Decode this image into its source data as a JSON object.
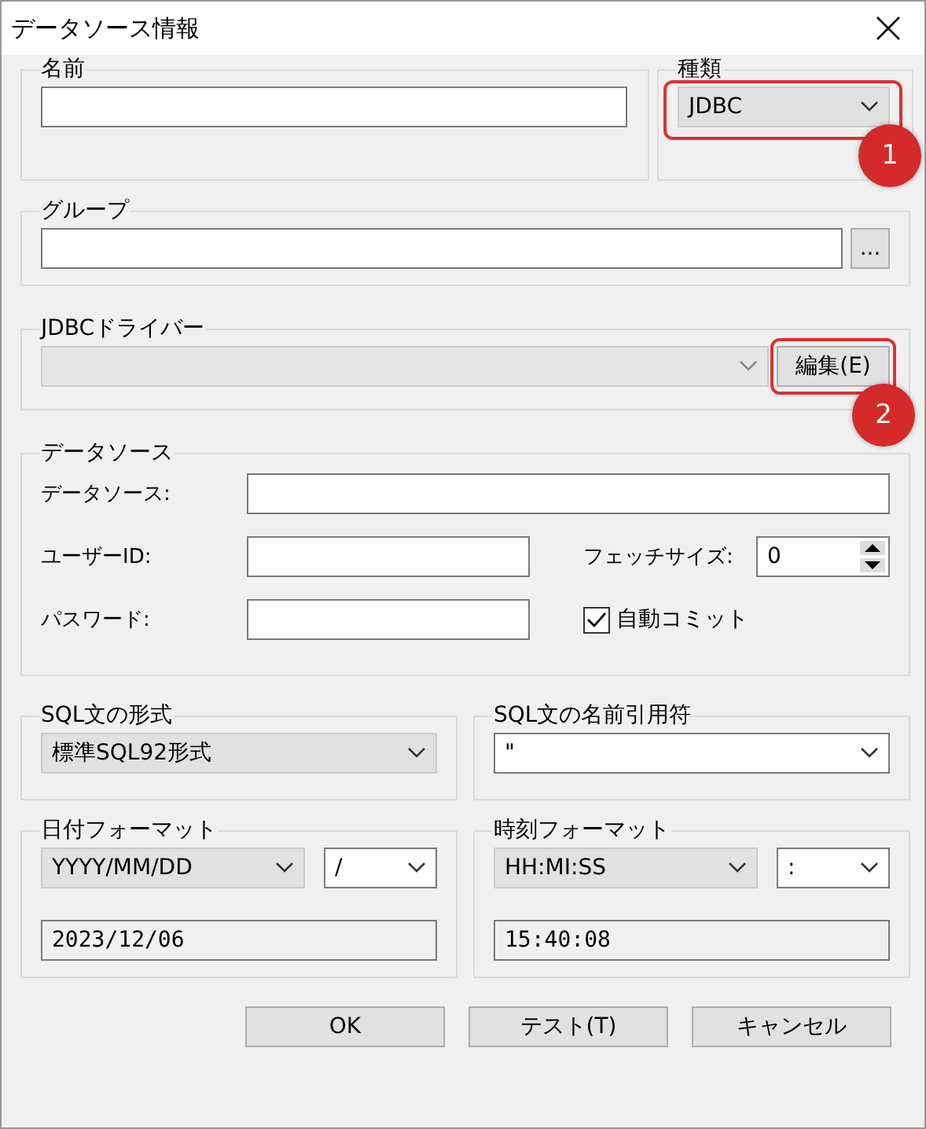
{
  "window": {
    "title": "データソース情報"
  },
  "name": {
    "label": "名前"
  },
  "type": {
    "label": "種類",
    "value": "JDBC"
  },
  "group": {
    "label": "グループ",
    "browse": "..."
  },
  "driver": {
    "label": "JDBCドライバー",
    "disabled": true,
    "edit_button": "編集(E)"
  },
  "datasource": {
    "label": "データソース",
    "source_label": "データソース:",
    "user_label": "ユーザーID:",
    "password_label": "パスワード:",
    "fetch_label": "フェッチサイズ:",
    "fetch_value": "0",
    "auto_commit": {
      "label": "自動コミット",
      "checked": true
    }
  },
  "sql_format": {
    "label": "SQL文の形式",
    "value": "標準SQL92形式"
  },
  "sql_quote": {
    "label": "SQL文の名前引用符",
    "value": "\""
  },
  "date_format": {
    "label": "日付フォーマット",
    "format": "YYYY/MM/DD",
    "separator": "/",
    "preview": "2023/12/06"
  },
  "time_format": {
    "label": "時刻フォーマット",
    "format": "HH:MI:SS",
    "separator": ":",
    "preview": "15:40:08"
  },
  "buttons": [
    "OK",
    "テスト(T)",
    "キャンセル"
  ],
  "annotations": [
    {
      "number": "1"
    },
    {
      "number": "2"
    }
  ]
}
